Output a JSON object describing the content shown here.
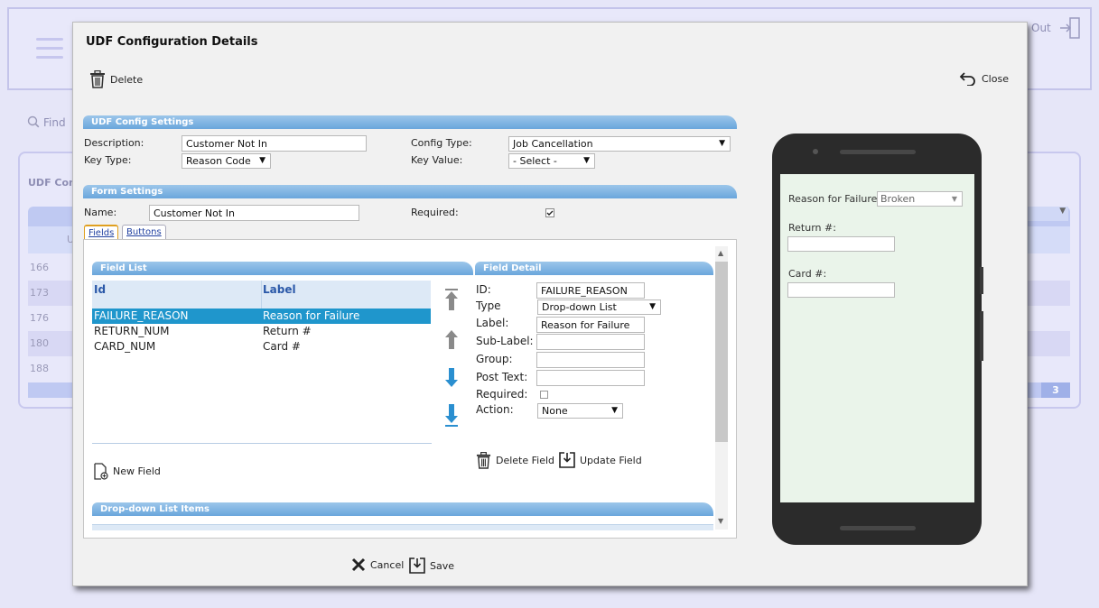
{
  "background": {
    "logout_label": "Out",
    "find_label": "Find",
    "panel_title": "UDF Confi",
    "grid_sub_label": "U",
    "rows": [
      "166",
      "173",
      "176",
      "180",
      "188"
    ],
    "pager_page": "3"
  },
  "modal": {
    "title": "UDF Configuration Details",
    "delete_label": "Delete",
    "close_label": "Close",
    "config_section": {
      "title": "UDF Config Settings",
      "description_label": "Description:",
      "description_value": "Customer Not In",
      "key_type_label": "Key Type:",
      "key_type_value": "Reason Code",
      "config_type_label": "Config Type:",
      "config_type_value": "Job Cancellation",
      "key_value_label": "Key Value:",
      "key_value_value": "- Select -"
    },
    "form_section": {
      "title": "Form Settings",
      "name_label": "Name:",
      "name_value": "Customer Not In",
      "required_label": "Required:",
      "required_checked": true
    },
    "tabs": [
      "Fields",
      "Buttons"
    ],
    "field_list": {
      "title": "Field List",
      "columns": [
        "Id",
        "Label"
      ],
      "rows": [
        {
          "id": "FAILURE_REASON",
          "label": "Reason for Failure",
          "selected": true
        },
        {
          "id": "RETURN_NUM",
          "label": "Return #",
          "selected": false
        },
        {
          "id": "CARD_NUM",
          "label": "Card #",
          "selected": false
        }
      ],
      "new_field_label": "New Field"
    },
    "field_detail": {
      "title": "Field Detail",
      "id_label": "ID:",
      "id_value": "FAILURE_REASON",
      "type_label": "Type",
      "type_value": "Drop-down List",
      "label_label": "Label:",
      "label_value": "Reason for Failure",
      "sublabel_label": "Sub-Label:",
      "sublabel_value": "",
      "group_label": "Group:",
      "group_value": "",
      "posttext_label": "Post Text:",
      "posttext_value": "",
      "required_label": "Required:",
      "action_label": "Action:",
      "action_value": "None",
      "delete_field_label": "Delete Field",
      "update_field_label": "Update Field"
    },
    "dropdown_items": {
      "title": "Drop-down List Items"
    },
    "cancel_label": "Cancel",
    "save_label": "Save"
  },
  "phone": {
    "reason_label": "Reason for Failure:",
    "reason_value": "Broken",
    "return_label": "Return #:",
    "card_label": "Card #:"
  },
  "colors": {
    "section_bar": "#6aa6dc",
    "selected_row": "#1f96cc",
    "phone_screen": "#eaf4ea",
    "background": "#e6e6f8"
  }
}
